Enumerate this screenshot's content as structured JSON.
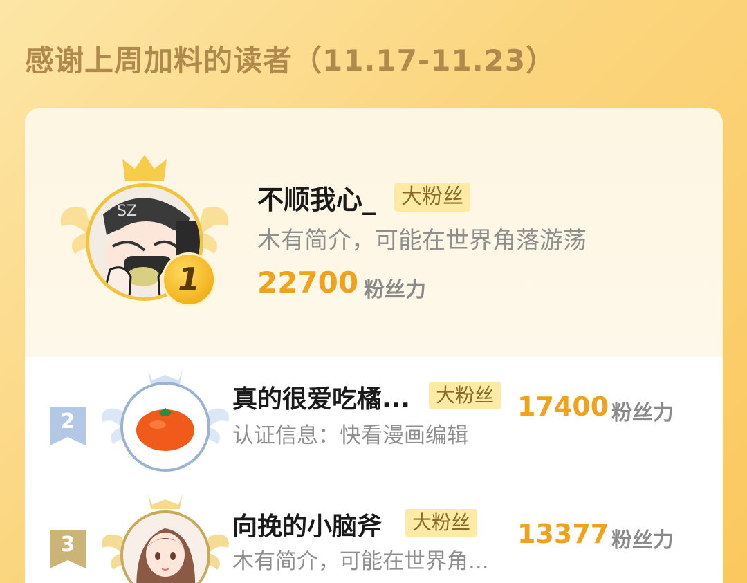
{
  "header": {
    "title": "感谢上周加料的读者（11.17-11.23）"
  },
  "colors": {
    "background_gradient": [
      "#fce6a6",
      "#fbc85f"
    ],
    "accent_gold": "#f0a21c",
    "tag_bg": "#fdeaa5",
    "tag_text": "#8a6a24"
  },
  "ranking": [
    {
      "rank": "1",
      "name": "不顺我心_",
      "tag": "大粉丝",
      "bio": "木有简介，可能在世界角落游荡",
      "score": "22700",
      "score_label": "粉丝力",
      "avatar_icon": "chibi-character-avatar"
    },
    {
      "rank": "2",
      "name": "真的很爱吃橘...",
      "tag": "大粉丝",
      "bio": "认证信息：快看漫画编辑",
      "score": "17400",
      "score_label": "粉丝力",
      "avatar_icon": "tangerine-avatar"
    },
    {
      "rank": "3",
      "name": "向挽的小脑斧",
      "tag": "大粉丝",
      "bio": "木有简介，可能在世界角...",
      "score": "13377",
      "score_label": "粉丝力",
      "avatar_icon": "anime-girl-avatar"
    }
  ]
}
